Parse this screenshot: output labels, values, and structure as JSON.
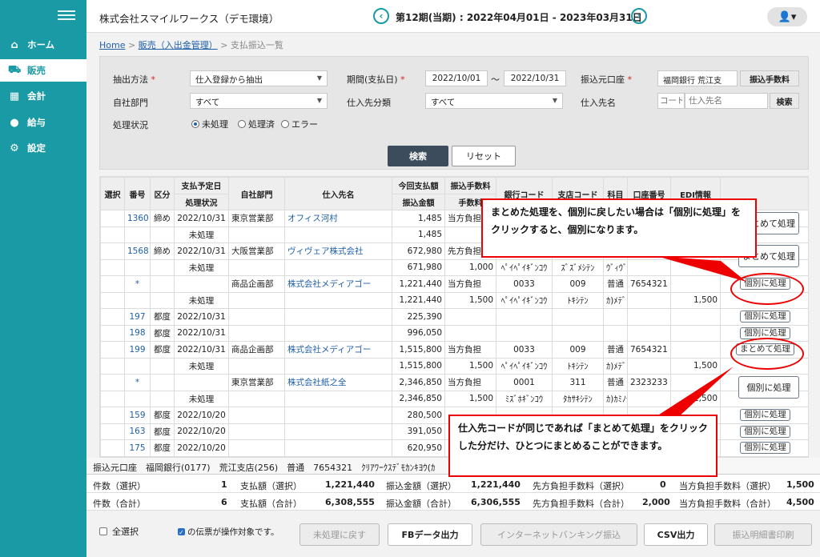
{
  "sidebar": {
    "items": [
      {
        "icon": "home-icon",
        "glyph": "⌂",
        "label": "ホーム"
      },
      {
        "icon": "cart-icon",
        "glyph": "🛒",
        "label": "販売"
      },
      {
        "icon": "calculator-icon",
        "glyph": "▦",
        "label": "会計"
      },
      {
        "icon": "moneybag-icon",
        "glyph": "💰",
        "label": "給与"
      },
      {
        "icon": "gear-icon",
        "glyph": "⚙",
        "label": "設定"
      }
    ]
  },
  "header": {
    "company": "株式会社スマイルワークス（デモ環境）",
    "period": "第12期(当期) : 2022年04月01日 - 2023年03月31日",
    "prev_glyph": "‹",
    "next_glyph": "›",
    "user_glyph": "👤▾"
  },
  "breadcrumb": {
    "home": "Home",
    "sep": ">",
    "sales": "販売（入出金管理）",
    "current": "支払振込一覧"
  },
  "filter": {
    "extract_label": "抽出方法",
    "extract_value": "仕入登録から抽出",
    "period_label": "期間(支払日)",
    "period_from": "2022/10/01",
    "tilde": "〜",
    "period_to": "2022/10/31",
    "account_label": "振込元口座",
    "account_value": "福岡銀行 荒江支",
    "fee_button": "振込手数料",
    "dept_label": "自社部門",
    "dept_value": "すべて",
    "supplier_class_label": "仕入先分類",
    "supplier_class_value": "すべて",
    "supplier_label": "仕入先名",
    "code_placeholder": "コード",
    "name_placeholder": "仕入先名",
    "supplier_search": "検索",
    "status_label": "処理状況",
    "status_options": [
      "未処理",
      "処理済",
      "エラー"
    ],
    "required_mark": "*",
    "search": "検索",
    "reset": "リセット"
  },
  "table": {
    "headers_top": [
      "選択",
      "番号",
      "区分",
      "支払予定日",
      "自社部門",
      "仕入先名",
      "今回支払額",
      "振込手数料",
      "銀行コード",
      "支店コード",
      "科目",
      "口座番号",
      "EDI情報"
    ],
    "headers_bottom": [
      "処理状況",
      "振込金額",
      "手数料"
    ],
    "rows": [
      [
        "",
        "1360",
        "締め",
        "2022/10/31",
        "東京営業部",
        "オフィス河村",
        "1,485",
        "当方負担",
        "",
        "",
        "",
        "",
        ""
      ],
      [
        "",
        "",
        "",
        "未処理",
        "",
        "",
        "1,485",
        "",
        "",
        "",
        "",
        "",
        ""
      ],
      [
        "",
        "1568",
        "締め",
        "2022/10/31",
        "大阪営業部",
        "ヴィヴェア株式会社",
        "672,980",
        "先方負担",
        "",
        "",
        "",
        "",
        ""
      ],
      [
        "",
        "",
        "",
        "未処理",
        "",
        "",
        "671,980",
        "1,000",
        "ﾍﾟｲﾍﾟｲｷﾞﾝｺｳ",
        "ｽﾞｽﾞﾒｼﾃﾝ",
        "ｳﾞｨｳﾞｴｱ",
        "",
        ""
      ],
      [
        "",
        "*",
        "",
        "",
        "商品企画部",
        "株式会社メディアゴー",
        "1,221,440",
        "当方負担",
        "0033",
        "009",
        "普通",
        "7654321",
        ""
      ],
      [
        "",
        "",
        "",
        "未処理",
        "",
        "",
        "1,221,440",
        "1,500",
        "ﾍﾟｲﾍﾟｲｷﾞﾝｺｳ",
        "ﾄｷｼﾃﾝ",
        "ｶ)ﾒﾃﾞｨｱｺﾞｰ",
        "",
        "1,500"
      ],
      [
        "",
        "197",
        "都度",
        "2022/10/31",
        "",
        "",
        "225,390",
        "",
        "",
        "",
        "",
        "",
        ""
      ],
      [
        "",
        "198",
        "都度",
        "2022/10/31",
        "",
        "",
        "996,050",
        "",
        "",
        "",
        "",
        "",
        ""
      ],
      [
        "",
        "199",
        "都度",
        "2022/10/31",
        "商品企画部",
        "株式会社メディアゴー",
        "1,515,800",
        "当方負担",
        "0033",
        "009",
        "普通",
        "7654321",
        ""
      ],
      [
        "",
        "",
        "",
        "未処理",
        "",
        "",
        "1,515,800",
        "1,500",
        "ﾍﾟｲﾍﾟｲｷﾞﾝｺｳ",
        "ﾄｷｼﾃﾝ",
        "ｶ)ﾒﾃﾞｨｱｺﾞｰ",
        "",
        "1,500"
      ],
      [
        "",
        "*",
        "",
        "",
        "東京営業部",
        "株式会社紙之全",
        "2,346,850",
        "当方負担",
        "0001",
        "311",
        "普通",
        "2323233",
        ""
      ],
      [
        "",
        "",
        "",
        "未処理",
        "",
        "",
        "2,346,850",
        "1,500",
        "ﾐｽﾞﾎｷﾞﾝｺｳ",
        "ﾀｶｻｷｼﾃﾝ",
        "ｶ)ｶﾐﾉｾﾞﾝ",
        "",
        "1,500"
      ],
      [
        "",
        "159",
        "都度",
        "2022/10/20",
        "",
        "",
        "280,500",
        "",
        "",
        "",
        "",
        "",
        ""
      ],
      [
        "",
        "163",
        "都度",
        "2022/10/20",
        "",
        "",
        "391,050",
        "",
        "",
        "",
        "",
        "",
        ""
      ],
      [
        "",
        "175",
        "都度",
        "2022/10/20",
        "",
        "",
        "620,950",
        "",
        "",
        "",
        "",
        "",
        ""
      ]
    ],
    "btn_merge": "まとめて処理",
    "btn_separate": "個別に処理",
    "check_mark": "✓"
  },
  "summary": {
    "account_line": "振込元口座　福岡銀行(0177)　荒江支店(256)　普通　7654321　ｸﾘｱﾜｰｸｽﾃﾞﾓｶﾝｷﾖｳ(ｶ",
    "sel_count_label": "件数（選択）",
    "sel_count": "1",
    "sel_pay_label": "支払額（選択）",
    "sel_pay": "1,221,440",
    "sel_trans_label": "振込金額（選択）",
    "sel_trans": "1,221,440",
    "sel_payee_fee_label": "先方負担手数料（選択）",
    "sel_payee_fee": "0",
    "sel_our_fee_label": "当方負担手数料（選択）",
    "sel_our_fee": "1,500",
    "tot_count_label": "件数（合計）",
    "tot_count": "6",
    "tot_pay_label": "支払額（合計）",
    "tot_pay": "6,308,555",
    "tot_trans_label": "振込金額（合計）",
    "tot_trans": "6,306,555",
    "tot_payee_fee_label": "先方負担手数料（合計）",
    "tot_payee_fee": "2,000",
    "tot_our_fee_label": "当方負担手数料（合計）",
    "tot_our_fee": "4,500"
  },
  "bottom": {
    "select_all": "全選択",
    "target_note": "の伝票が操作対象です。",
    "btn_unprocess": "未処理に戻す",
    "btn_fb": "FBデータ出力",
    "btn_netbank": "インターネットバンキング振込",
    "btn_csv": "CSV出力",
    "btn_print": "振込明細書印刷"
  },
  "callouts": {
    "top": "まとめた処理を、個別に戻したい場合は「個別に処理」をクリックすると、個別になります。",
    "bottom": "仕入先コードが同じであれば「まとめて処理」をクリックした分だけ、ひとつにまとめることができます。"
  }
}
